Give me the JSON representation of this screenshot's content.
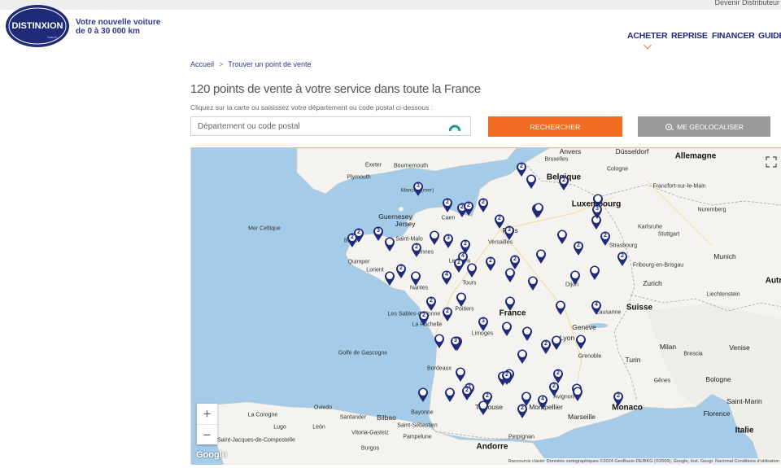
{
  "header": {
    "devenir": "Devenir Distributeur",
    "logo_text": "DISTINXION",
    "logo_sub": "Auto.fr",
    "tagline_line1": "Votre nouvelle voiture",
    "tagline_line2": "de 0 à 30 000 km"
  },
  "nav": {
    "items": [
      "ACHETER",
      "REPRISE",
      "FINANCER",
      "GUIDES"
    ],
    "active": "ACHETER"
  },
  "breadcrumb": {
    "home": "Accueil",
    "separator": ">",
    "current": "Trouver un point de vente"
  },
  "page": {
    "title": "120 points de vente à votre service dans toute la France",
    "subtitle": "Cliquez sur la carte ou saisissez votre département ou code postal ci-dessous :"
  },
  "search": {
    "placeholder": "Département ou code postal",
    "value": "",
    "submit_label": "RECHERCHER",
    "geo_label": "ME GÉOLOCALISER"
  },
  "colors": {
    "brand_blue": "#2b3990",
    "accent_orange": "#f26d21",
    "geo_gray": "#9a9a9a",
    "sea": "#a4cbe8",
    "land": "#f5f3ef"
  },
  "map": {
    "labels": {
      "anvers": "Anvers",
      "dusseldorf": "Düsseldorf",
      "allemagne": "Allemagne",
      "bruxelles": "Bruxelles",
      "belgique": "Belgique",
      "cologne": "Cologne",
      "francfort": "Francfort-sur-le-Main",
      "luxembourg": "Luxembourg",
      "nuremberg": "Nuremberg",
      "karlsruhe": "Karlsruhe",
      "stuttgart": "Stuttgart",
      "munich": "Munich",
      "strasbourg": "Strasbourg",
      "fribourg": "Fribourg-en-Brisgau",
      "zurich": "Zurich",
      "suisse": "Suisse",
      "autriche": "Autr",
      "liechtenstein": "Liechtenstein",
      "exeter": "Exeter",
      "bournemouth": "Bournemouth",
      "plymouth": "Plymouth",
      "manche": "Manche (mer)",
      "guernesey": "Guernesey",
      "jersey": "Jersey",
      "caen": "Caen",
      "paris": "Paris",
      "versailles": "Versailles",
      "mer_celtique": "Mer Celtique",
      "brest": "Brest",
      "saint_malo": "Saint-Malo",
      "rennes": "Rennes",
      "quimper": "Quimper",
      "lorient": "Lorient",
      "le_mans": "Le Mans",
      "nantes": "Nantes",
      "tours": "Tours",
      "dijon": "Dijon",
      "france": "France",
      "les_sables": "Les Sables-d'Olonne",
      "la_rochelle": "La Rochelle",
      "poitiers": "Poitiers",
      "limoges": "Limoges",
      "lausanne": "Lausanne",
      "geneve": "Genève",
      "lyon": "Lyon",
      "grenoble": "Grenoble",
      "milan": "Milan",
      "brescia": "Brescia",
      "venise": "Venise",
      "turin": "Turin",
      "genes": "Gênes",
      "bologne": "Bologne",
      "golfe": "Golfe de Gascogne",
      "bordeaux": "Bordeaux",
      "toulouse": "Toulouse",
      "montpellier": "Montpellier",
      "avignon": "Avignon",
      "marseille": "Marseille",
      "monaco": "Monaco",
      "saint_marin": "Saint-Marin",
      "florence": "Florence",
      "italie": "Italie",
      "la_corogne": "La Corogne",
      "oviedo": "Oviedo",
      "santander": "Santander",
      "bilbao": "Bilbao",
      "lugo": "Lugo",
      "saint_sebastien": "Saint-Sébastien",
      "saint_jacques": "Saint-Jacques-de-Compostelle",
      "leon": "León",
      "burgos": "Burgos",
      "pampelune": "Pampelune",
      "vitoria": "Vitoria-Gasteiz",
      "bayonne": "Bayonne",
      "perpignan": "Perpignan",
      "andorre": "Andorre"
    },
    "zoom_in": "+",
    "zoom_out": "−",
    "google": "Google",
    "attribution": "Raccourcis clavier  Données cartographiques ©2024 GeoBasis-DE/BKG (©2009), Google, Inst. Geogr. Nacional  Conditions d'utilisation",
    "pins": [
      "",
      "2",
      "2",
      "3",
      "",
      "2",
      "3",
      "2",
      "2",
      "2",
      "2",
      "3",
      "",
      "3",
      "2",
      "2",
      "",
      "2",
      "",
      "3",
      "2",
      "4",
      "2",
      "",
      "2",
      "",
      "2",
      "",
      "",
      "",
      "2",
      "",
      "2",
      "2",
      "3",
      "",
      "",
      "2",
      "",
      "",
      "4",
      "",
      "2",
      "",
      "2",
      "3",
      "",
      "",
      "",
      "2",
      "",
      "4",
      "",
      "",
      "2",
      "",
      "2",
      "2",
      "",
      "",
      "2",
      "",
      "",
      "2",
      "",
      "2",
      "4",
      "2",
      "",
      "2",
      "",
      "2",
      "3",
      "2",
      ""
    ]
  }
}
